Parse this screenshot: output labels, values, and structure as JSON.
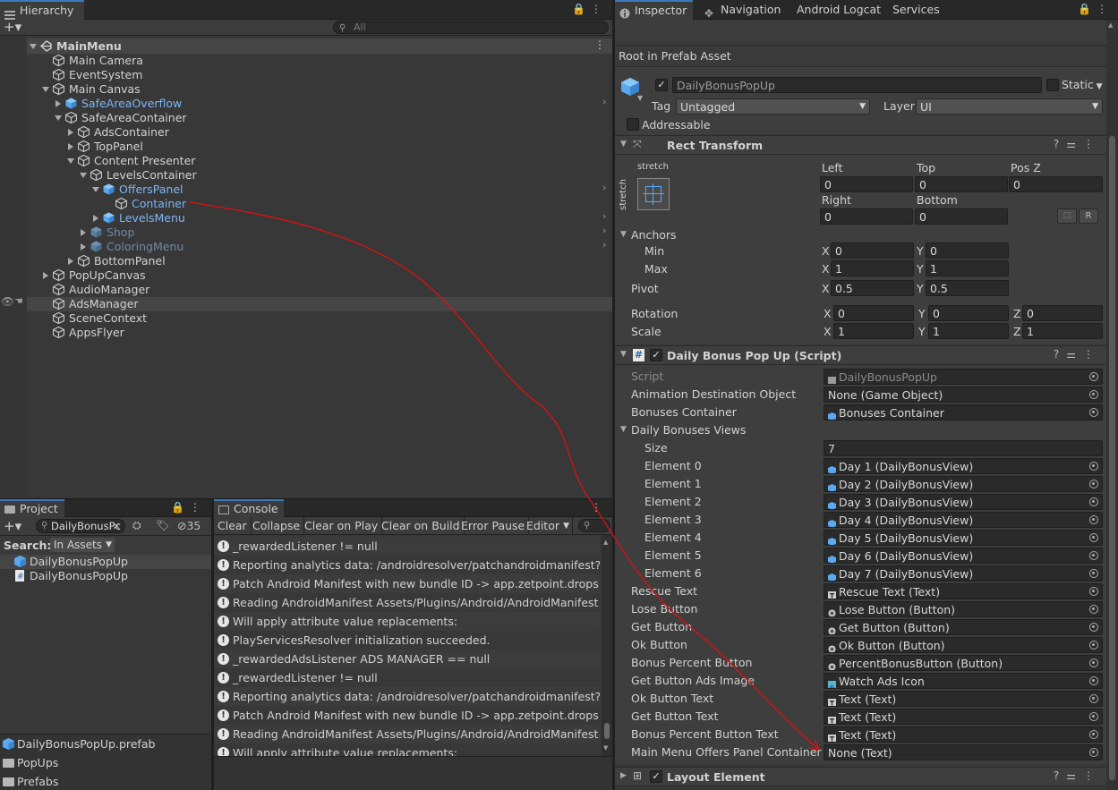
{
  "hierarchy": {
    "tab_label": "Hierarchy",
    "search_placeholder": "All",
    "rows": [
      {
        "label": "MainMenu",
        "indent": 0,
        "expand": "down",
        "icon": "unity-scene-icon",
        "style": "bold"
      },
      {
        "label": "Main Camera",
        "indent": 1,
        "expand": "",
        "icon": "gameobject-icon",
        "style": ""
      },
      {
        "label": "EventSystem",
        "indent": 1,
        "expand": "",
        "icon": "gameobject-icon",
        "style": ""
      },
      {
        "label": "Main Canvas",
        "indent": 1,
        "expand": "down",
        "icon": "gameobject-icon",
        "style": ""
      },
      {
        "label": "SafeAreaOverflow",
        "indent": 2,
        "expand": "right",
        "icon": "prefab-icon",
        "style": "blue"
      },
      {
        "label": "SafeAreaContainer",
        "indent": 2,
        "expand": "down",
        "icon": "gameobject-icon",
        "style": ""
      },
      {
        "label": "AdsContainer",
        "indent": 3,
        "expand": "right",
        "icon": "gameobject-icon",
        "style": ""
      },
      {
        "label": "TopPanel",
        "indent": 3,
        "expand": "right",
        "icon": "gameobject-icon",
        "style": ""
      },
      {
        "label": "Content Presenter",
        "indent": 3,
        "expand": "down",
        "icon": "gameobject-icon",
        "style": ""
      },
      {
        "label": "LevelsContainer",
        "indent": 4,
        "expand": "down",
        "icon": "gameobject-icon",
        "style": ""
      },
      {
        "label": "OffersPanel",
        "indent": 5,
        "expand": "down",
        "icon": "prefab-icon",
        "style": "blue"
      },
      {
        "label": "Container",
        "indent": 6,
        "expand": "",
        "icon": "gameobject-icon",
        "style": "blue"
      },
      {
        "label": "LevelsMenu",
        "indent": 5,
        "expand": "right",
        "icon": "prefab-icon",
        "style": "blue"
      },
      {
        "label": "Shop",
        "indent": 4,
        "expand": "right",
        "icon": "prefab-icon",
        "style": "dim"
      },
      {
        "label": "ColoringMenu",
        "indent": 4,
        "expand": "right",
        "icon": "prefab-icon",
        "style": "dim"
      },
      {
        "label": "BottomPanel",
        "indent": 3,
        "expand": "right",
        "icon": "gameobject-icon",
        "style": ""
      },
      {
        "label": "PopUpCanvas",
        "indent": 1,
        "expand": "right",
        "icon": "gameobject-icon",
        "style": ""
      },
      {
        "label": "AudioManager",
        "indent": 1,
        "expand": "",
        "icon": "gameobject-icon",
        "style": ""
      },
      {
        "label": "AdsManager",
        "indent": 1,
        "expand": "",
        "icon": "gameobject-icon",
        "style": "hover"
      },
      {
        "label": "SceneContext",
        "indent": 1,
        "expand": "",
        "icon": "gameobject-icon",
        "style": ""
      },
      {
        "label": "AppsFlyer",
        "indent": 1,
        "expand": "",
        "icon": "gameobject-icon",
        "style": ""
      }
    ]
  },
  "project": {
    "tab_label": "Project",
    "search_value": "DailyBonusPc",
    "hidden_count": "35",
    "search_label": "Search:",
    "search_scope": "In Assets",
    "results": [
      "DailyBonusPopUp",
      "DailyBonusPopUp"
    ],
    "folders": [
      "DailyBonusPopUp.prefab",
      "PopUps",
      "Prefabs"
    ]
  },
  "console": {
    "tab_label": "Console",
    "buttons": [
      "Clear",
      "Collapse",
      "Clear on Play",
      "Clear on Build",
      "Error Pause",
      "Editor"
    ],
    "logs": [
      "_rewardedListener != null",
      "Reporting analytics data: /androidresolver/patchandroidmanifest?unityVer",
      "Patch Android Manifest with new bundle ID  -> app.zetpoint.drops",
      "Reading AndroidManifest Assets/Plugins/Android/AndroidManifest.xml",
      "Will apply attribute value replacements:",
      "PlayServicesResolver initialization succeeded.",
      "_rewardedAdsListener ADS MANAGER == null",
      "_rewardedListener != null",
      "Reporting analytics data: /androidresolver/patchandroidmanifest?unityVer",
      "Patch Android Manifest with new bundle ID  -> app.zetpoint.drops",
      "Reading AndroidManifest Assets/Plugins/Android/AndroidManifest.xml",
      "Will apply attribute value replacements:"
    ]
  },
  "inspector": {
    "tabs": [
      "Inspector",
      "Navigation",
      "Android Logcat",
      "Services"
    ],
    "root_label": "Root in Prefab Asset",
    "object_name": "DailyBonusPopUp",
    "static_label": "Static",
    "tag_label": "Tag",
    "tag_value": "Untagged",
    "layer_label": "Layer",
    "layer_value": "UI",
    "addressable_label": "Addressable",
    "rect_transform": {
      "title": "Rect Transform",
      "stretch_label": "stretch",
      "left_label": "Left",
      "left": "0",
      "top_label": "Top",
      "top": "0",
      "posz_label": "Pos Z",
      "posz": "0",
      "right_label": "Right",
      "right": "0",
      "bottom_label": "Bottom",
      "bottom": "0",
      "r_button": "R",
      "anchors_label": "Anchors",
      "min_label": "Min",
      "min_x": "0",
      "min_y": "0",
      "max_label": "Max",
      "max_x": "1",
      "max_y": "1",
      "pivot_label": "Pivot",
      "pivot_x": "0.5",
      "pivot_y": "0.5",
      "rotation_label": "Rotation",
      "rot_x": "0",
      "rot_y": "0",
      "rot_z": "0",
      "scale_label": "Scale",
      "scale_x": "1",
      "scale_y": "1",
      "scale_z": "1",
      "x": "X",
      "y": "Y",
      "z": "Z"
    },
    "script_component": {
      "title": "Daily Bonus Pop Up (Script)",
      "fields": [
        {
          "label": "Script",
          "value": "DailyBonusPopUp",
          "kind": "script",
          "indent": 0,
          "disabled": true
        },
        {
          "label": "Animation Destination Object",
          "value": "None (Game Object)",
          "kind": "none",
          "indent": 0
        },
        {
          "label": "Bonuses Container",
          "value": "Bonuses Container",
          "kind": "obj",
          "indent": 0
        },
        {
          "label": "Daily Bonuses Views",
          "value": "",
          "kind": "foldout",
          "indent": 0
        },
        {
          "label": "Size",
          "value": "7",
          "kind": "int",
          "indent": 1
        },
        {
          "label": "Element 0",
          "value": "Day 1 (DailyBonusView)",
          "kind": "obj",
          "indent": 1
        },
        {
          "label": "Element 1",
          "value": "Day 2 (DailyBonusView)",
          "kind": "obj",
          "indent": 1
        },
        {
          "label": "Element 2",
          "value": "Day 3 (DailyBonusView)",
          "kind": "obj",
          "indent": 1
        },
        {
          "label": "Element 3",
          "value": "Day 4 (DailyBonusView)",
          "kind": "obj",
          "indent": 1
        },
        {
          "label": "Element 4",
          "value": "Day 5 (DailyBonusView)",
          "kind": "obj",
          "indent": 1
        },
        {
          "label": "Element 5",
          "value": "Day 6 (DailyBonusView)",
          "kind": "obj",
          "indent": 1
        },
        {
          "label": "Element 6",
          "value": "Day 7 (DailyBonusView)",
          "kind": "obj",
          "indent": 1
        },
        {
          "label": "Rescue Text",
          "value": "Rescue Text (Text)",
          "kind": "text",
          "indent": 0
        },
        {
          "label": "Lose Button",
          "value": "Lose Button (Button)",
          "kind": "button",
          "indent": 0
        },
        {
          "label": "Get Button",
          "value": "Get Button (Button)",
          "kind": "button",
          "indent": 0
        },
        {
          "label": "Ok Button",
          "value": "Ok Button (Button)",
          "kind": "button",
          "indent": 0
        },
        {
          "label": "Bonus Percent Button",
          "value": "PercentBonusButton (Button)",
          "kind": "button",
          "indent": 0
        },
        {
          "label": "Get Button Ads Image",
          "value": "Watch Ads Icon",
          "kind": "image",
          "indent": 0
        },
        {
          "label": "Ok Button Text",
          "value": "Text (Text)",
          "kind": "text",
          "indent": 0
        },
        {
          "label": "Get Button Text",
          "value": "Text (Text)",
          "kind": "text",
          "indent": 0
        },
        {
          "label": "Bonus Percent Button Text",
          "value": "Text (Text)",
          "kind": "text",
          "indent": 0
        },
        {
          "label": "Main Menu Offers Panel Container",
          "value": "None (Text)",
          "kind": "none",
          "indent": 0
        }
      ]
    },
    "layout_element": {
      "title": "Layout Element"
    }
  },
  "colors": {
    "accent": "#3a79bb",
    "prefab_blue": "#7cb6f5",
    "annotation": "#e01010"
  }
}
